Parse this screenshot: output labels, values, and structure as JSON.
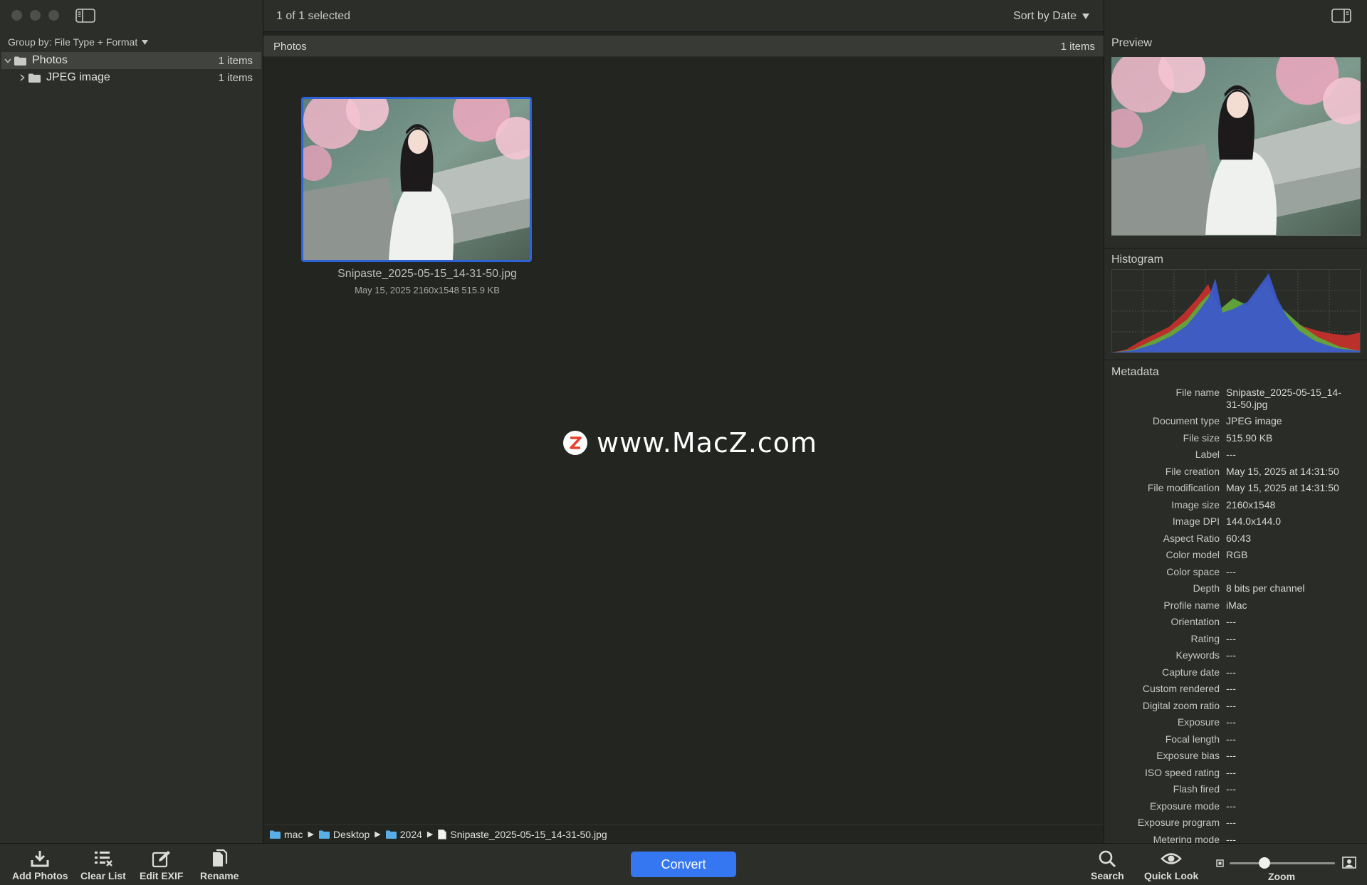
{
  "sidebar": {
    "group_by": "Group by: File Type + Format",
    "tree": [
      {
        "label": "Photos",
        "count": "1 items"
      },
      {
        "label": "JPEG image",
        "count": "1 items"
      }
    ]
  },
  "main": {
    "selection": "1 of 1 selected",
    "sort": "Sort by Date",
    "section_title": "Photos",
    "section_count": "1 items",
    "item": {
      "filename": "Snipaste_2025-05-15_14-31-50.jpg",
      "meta": "May 15, 2025  2160x1548  515.9 KB"
    },
    "watermark": "www.MacZ.com",
    "path": [
      "mac",
      "Desktop",
      "2024",
      "Snipaste_2025-05-15_14-31-50.jpg"
    ]
  },
  "inspector": {
    "preview_label": "Preview",
    "histogram_label": "Histogram",
    "metadata_label": "Metadata",
    "metadata": [
      {
        "k": "File name",
        "v": "Snipaste_2025-05-15_14-31-50.jpg"
      },
      {
        "k": "Document type",
        "v": "JPEG image"
      },
      {
        "k": "File size",
        "v": "515.90 KB"
      },
      {
        "k": "Label",
        "v": "---"
      },
      {
        "k": "File creation",
        "v": "May 15, 2025 at 14:31:50"
      },
      {
        "k": "File modification",
        "v": "May 15, 2025 at 14:31:50"
      },
      {
        "k": "Image size",
        "v": "2160x1548"
      },
      {
        "k": "Image DPI",
        "v": "144.0x144.0"
      },
      {
        "k": "Aspect Ratio",
        "v": "60:43"
      },
      {
        "k": "Color model",
        "v": "RGB"
      },
      {
        "k": "Color space",
        "v": "---"
      },
      {
        "k": "Depth",
        "v": "8 bits per channel"
      },
      {
        "k": "Profile name",
        "v": "iMac"
      },
      {
        "k": "Orientation",
        "v": "---"
      },
      {
        "k": "Rating",
        "v": "---"
      },
      {
        "k": "Keywords",
        "v": "---"
      },
      {
        "k": "Capture date",
        "v": "---"
      },
      {
        "k": "Custom rendered",
        "v": "---"
      },
      {
        "k": "Digital zoom ratio",
        "v": "---"
      },
      {
        "k": "Exposure",
        "v": "---"
      },
      {
        "k": "Focal length",
        "v": "---"
      },
      {
        "k": "Exposure bias",
        "v": "---"
      },
      {
        "k": "ISO speed rating",
        "v": "---"
      },
      {
        "k": "Flash fired",
        "v": "---"
      },
      {
        "k": "Exposure mode",
        "v": "---"
      },
      {
        "k": "Exposure program",
        "v": "---"
      },
      {
        "k": "Metering mode",
        "v": "---"
      }
    ]
  },
  "toolbar": {
    "add_photos": "Add Photos",
    "clear_list": "Clear List",
    "edit_exif": "Edit EXIF",
    "rename": "Rename",
    "convert": "Convert",
    "search": "Search",
    "quick_look": "Quick Look",
    "zoom": "Zoom",
    "zoom_level": 0.33
  },
  "colors": {
    "accent": "#3577f0",
    "selection_border": "#2e63d8",
    "folder_blue": "#5aaee8"
  }
}
